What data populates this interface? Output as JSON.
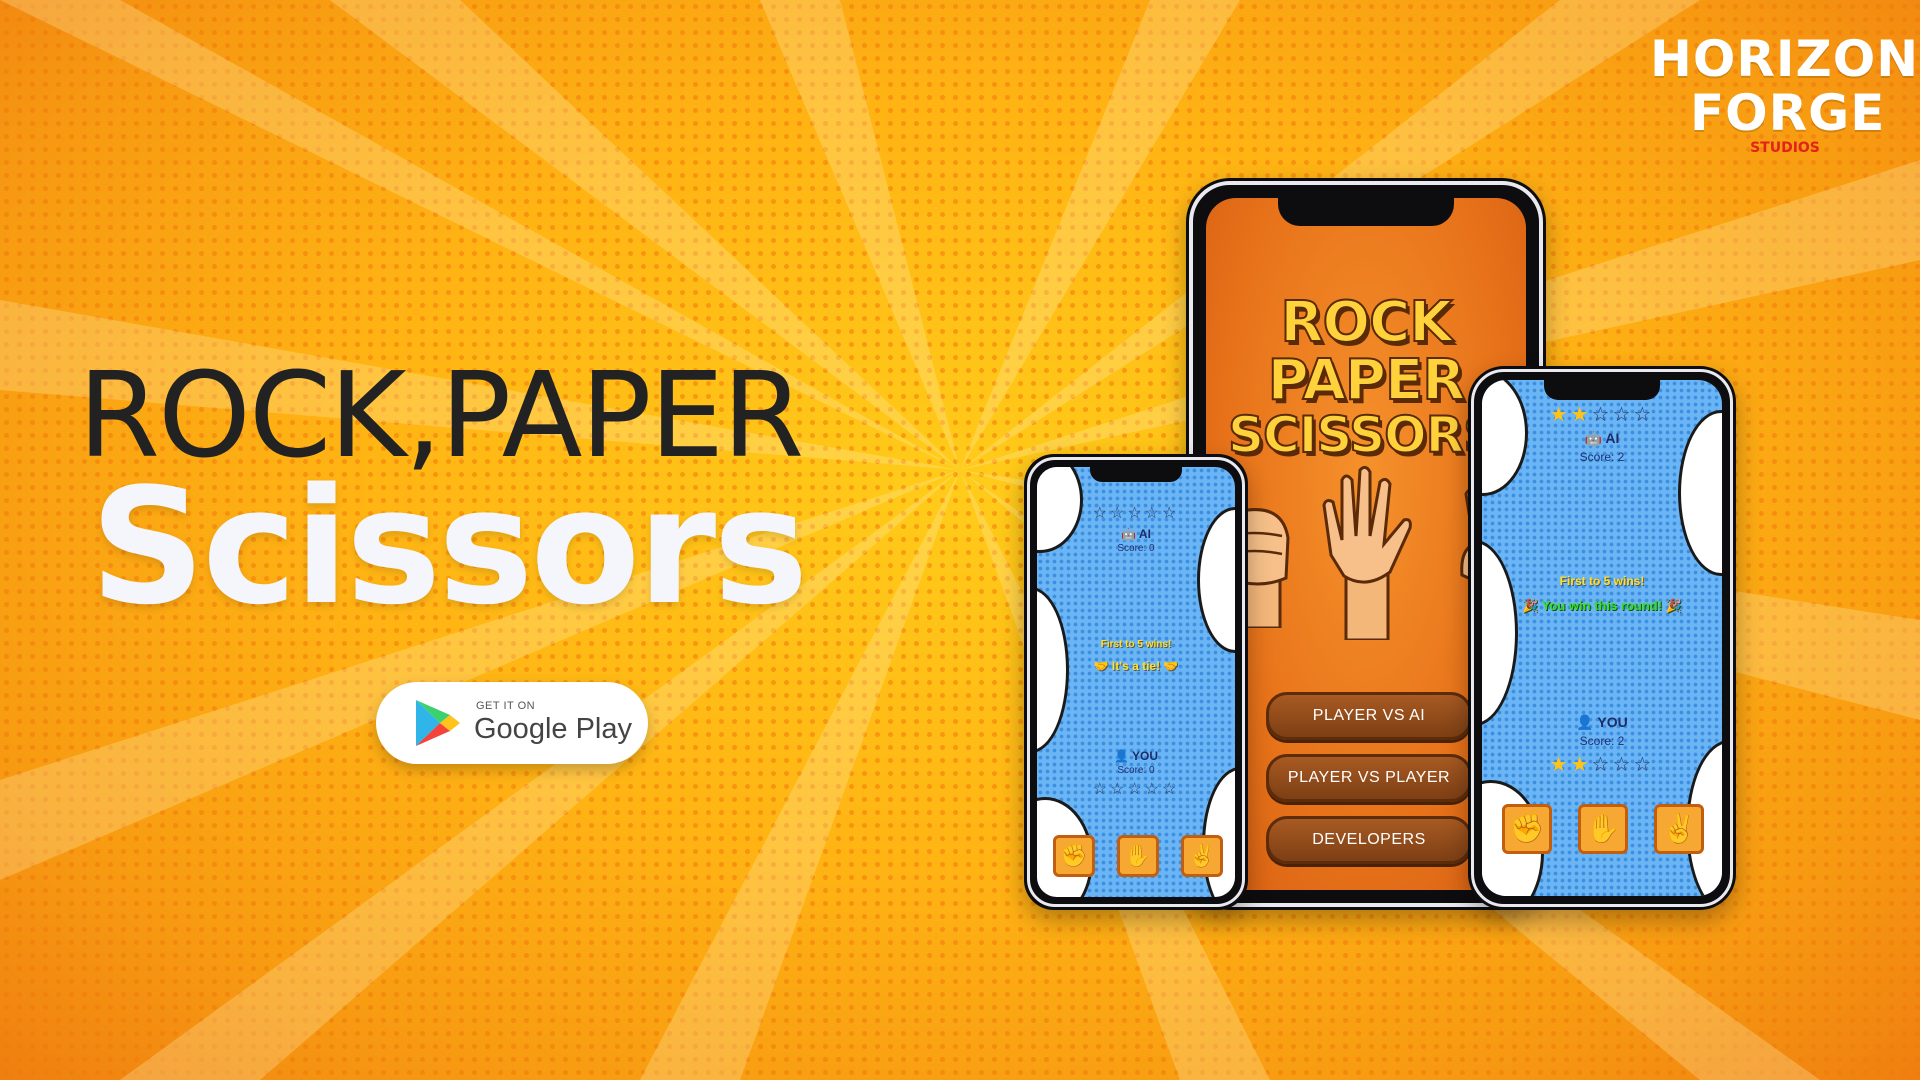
{
  "logo": {
    "line1": "HORIZON",
    "line2": "FORGE",
    "line3": "STUDIOS"
  },
  "headline": {
    "line1": "ROCK,PAPER",
    "line2": "Scissors"
  },
  "store_badge": {
    "small": "GET IT ON",
    "big": "Google Play"
  },
  "colors": {
    "accent": "#ffb414",
    "button": "#8b4a1a",
    "game_bg": "#6bb5f5"
  },
  "center_phone": {
    "title_lines": [
      "ROCK",
      "PAPER",
      "SCISSORS"
    ],
    "buttons": [
      "PLAYER VS AI",
      "PLAYER VS PLAYER",
      "DEVELOPERS"
    ],
    "hand_icons": [
      "rock-hand-icon",
      "paper-hand-icon",
      "scissors-hand-icon"
    ]
  },
  "left_phone": {
    "ai_label": "🤖 AI",
    "ai_score": "Score: 0",
    "ai_stars": 0,
    "rule": "First to 5 wins!",
    "result": "🤝 It's a tie! 🤝",
    "you_label": "👤 YOU",
    "you_score": "Score: 0",
    "you_stars": 0,
    "moves": [
      "rock-icon",
      "paper-icon",
      "scissors-icon"
    ]
  },
  "right_phone": {
    "ai_label": "🤖 AI",
    "ai_score": "Score: 2",
    "ai_stars": 2,
    "rule": "First to 5 wins!",
    "result": "🎉 You win this round! 🎉",
    "you_label": "👤 YOU",
    "you_score": "Score: 2",
    "you_stars": 2,
    "moves": [
      "rock-icon",
      "paper-icon",
      "scissors-icon"
    ]
  }
}
